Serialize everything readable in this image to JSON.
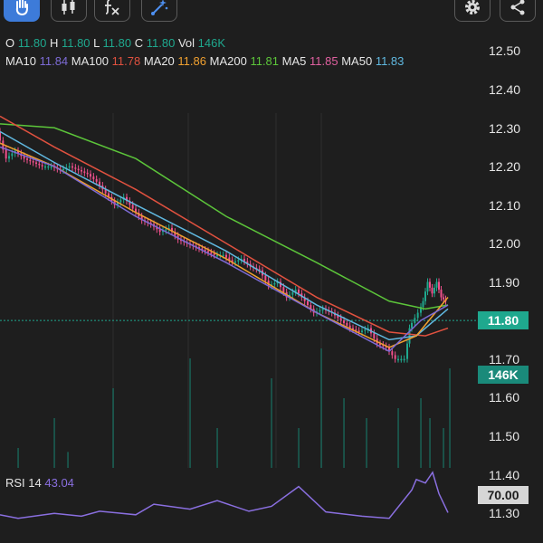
{
  "toolbar": {
    "buttons": [
      {
        "icon": "hand-icon",
        "active": true
      },
      {
        "icon": "candlestick-icon",
        "active": false
      },
      {
        "icon": "indicator-fx-icon",
        "active": false
      },
      {
        "icon": "drawing-tools-icon",
        "active": false
      }
    ],
    "right_buttons": [
      {
        "icon": "gear-icon"
      },
      {
        "icon": "share-icon"
      }
    ]
  },
  "ohlc": {
    "o_label": "O",
    "o": "11.80",
    "h_label": "H",
    "h": "11.80",
    "l_label": "L",
    "l": "11.80",
    "c_label": "C",
    "c": "11.80",
    "vol_label": "Vol",
    "vol": "146K"
  },
  "ma": [
    {
      "label": "MA10",
      "value": "11.84",
      "color": "#7d6bd6"
    },
    {
      "label": "MA100",
      "value": "11.78",
      "color": "#e0513f"
    },
    {
      "label": "MA20",
      "value": "11.86",
      "color": "#f0a030"
    },
    {
      "label": "MA200",
      "value": "11.81",
      "color": "#5cc53a"
    },
    {
      "label": "MA5",
      "value": "11.85",
      "color": "#e060a0"
    },
    {
      "label": "MA50",
      "value": "11.83",
      "color": "#60b8e0"
    }
  ],
  "price_axis": {
    "ticks": [
      "12.50",
      "12.40",
      "12.30",
      "12.20",
      "12.10",
      "12.00",
      "11.90",
      "11.70",
      "11.60",
      "11.50",
      "11.40",
      "11.30"
    ],
    "current_price": "11.80",
    "current_volume": "146K",
    "rsi_level": "70.00"
  },
  "rsi": {
    "label": "RSI 14",
    "value": "43.04",
    "color": "#8a6fe0"
  },
  "colors": {
    "up": "#1fa88e",
    "down": "#f0508c",
    "price_badge_bg": "#1fa88e",
    "volume_badge_bg": "#1a8a7a",
    "rsi_badge_bg": "#d6d6d6"
  },
  "chart_data": {
    "type": "candlestick",
    "price_range": [
      11.25,
      12.55
    ],
    "close_path": [
      [
        0,
        12.29
      ],
      [
        10,
        12.22
      ],
      [
        20,
        12.24
      ],
      [
        30,
        12.22
      ],
      [
        40,
        12.21
      ],
      [
        50,
        12.2
      ],
      [
        60,
        12.2
      ],
      [
        70,
        12.19
      ],
      [
        80,
        12.2
      ],
      [
        90,
        12.19
      ],
      [
        100,
        12.18
      ],
      [
        110,
        12.16
      ],
      [
        120,
        12.13
      ],
      [
        130,
        12.1
      ],
      [
        140,
        12.12
      ],
      [
        150,
        12.09
      ],
      [
        160,
        12.06
      ],
      [
        170,
        12.05
      ],
      [
        180,
        12.03
      ],
      [
        190,
        12.04
      ],
      [
        200,
        12.01
      ],
      [
        210,
        12.0
      ],
      [
        220,
        11.99
      ],
      [
        230,
        11.98
      ],
      [
        240,
        11.97
      ],
      [
        250,
        11.97
      ],
      [
        260,
        11.95
      ],
      [
        270,
        11.96
      ],
      [
        280,
        11.94
      ],
      [
        290,
        11.93
      ],
      [
        300,
        11.89
      ],
      [
        310,
        11.9
      ],
      [
        320,
        11.86
      ],
      [
        330,
        11.88
      ],
      [
        340,
        11.85
      ],
      [
        350,
        11.82
      ],
      [
        360,
        11.83
      ],
      [
        370,
        11.82
      ],
      [
        380,
        11.8
      ],
      [
        390,
        11.78
      ],
      [
        400,
        11.77
      ],
      [
        410,
        11.78
      ],
      [
        420,
        11.74
      ],
      [
        430,
        11.73
      ],
      [
        440,
        11.7
      ],
      [
        450,
        11.7
      ],
      [
        455,
        11.78
      ],
      [
        465,
        11.82
      ],
      [
        470,
        11.85
      ],
      [
        475,
        11.9
      ],
      [
        480,
        11.87
      ],
      [
        485,
        11.9
      ],
      [
        490,
        11.86
      ],
      [
        495,
        11.85
      ]
    ],
    "ma_curves": {
      "MA200": [
        [
          0,
          12.31
        ],
        [
          60,
          12.3
        ],
        [
          150,
          12.22
        ],
        [
          250,
          12.07
        ],
        [
          350,
          11.95
        ],
        [
          430,
          11.85
        ],
        [
          470,
          11.83
        ],
        [
          495,
          11.84
        ]
      ],
      "MA100": [
        [
          0,
          12.33
        ],
        [
          60,
          12.25
        ],
        [
          150,
          12.14
        ],
        [
          250,
          12.0
        ],
        [
          350,
          11.86
        ],
        [
          430,
          11.77
        ],
        [
          470,
          11.76
        ],
        [
          495,
          11.78
        ]
      ],
      "MA50": [
        [
          0,
          12.29
        ],
        [
          60,
          12.21
        ],
        [
          150,
          12.1
        ],
        [
          250,
          11.98
        ],
        [
          350,
          11.84
        ],
        [
          430,
          11.75
        ],
        [
          460,
          11.76
        ],
        [
          495,
          11.83
        ]
      ],
      "MA20": [
        [
          0,
          12.26
        ],
        [
          60,
          12.2
        ],
        [
          150,
          12.08
        ],
        [
          250,
          11.96
        ],
        [
          350,
          11.82
        ],
        [
          430,
          11.73
        ],
        [
          460,
          11.76
        ],
        [
          495,
          11.86
        ]
      ],
      "MA10": [
        [
          0,
          12.25
        ],
        [
          60,
          12.2
        ],
        [
          150,
          12.07
        ],
        [
          250,
          11.95
        ],
        [
          350,
          11.82
        ],
        [
          430,
          11.72
        ],
        [
          465,
          11.8
        ],
        [
          495,
          11.84
        ]
      ]
    },
    "volume": [
      [
        20,
        0.1
      ],
      [
        60,
        0.25
      ],
      [
        75,
        0.08
      ],
      [
        125,
        0.4
      ],
      [
        210,
        0.55
      ],
      [
        240,
        0.2
      ],
      [
        300,
        0.45
      ],
      [
        330,
        0.2
      ],
      [
        355,
        0.6
      ],
      [
        380,
        0.35
      ],
      [
        405,
        0.25
      ],
      [
        440,
        0.3
      ],
      [
        465,
        0.35
      ],
      [
        475,
        0.25
      ],
      [
        490,
        0.2
      ],
      [
        497,
        0.5
      ]
    ],
    "rsi_series": [
      [
        0,
        40
      ],
      [
        20,
        35
      ],
      [
        60,
        42
      ],
      [
        90,
        38
      ],
      [
        110,
        45
      ],
      [
        150,
        40
      ],
      [
        170,
        55
      ],
      [
        210,
        48
      ],
      [
        240,
        60
      ],
      [
        275,
        45
      ],
      [
        300,
        52
      ],
      [
        330,
        80
      ],
      [
        360,
        44
      ],
      [
        400,
        38
      ],
      [
        430,
        35
      ],
      [
        455,
        75
      ],
      [
        460,
        90
      ],
      [
        470,
        85
      ],
      [
        478,
        100
      ],
      [
        485,
        70
      ],
      [
        495,
        43
      ]
    ]
  }
}
